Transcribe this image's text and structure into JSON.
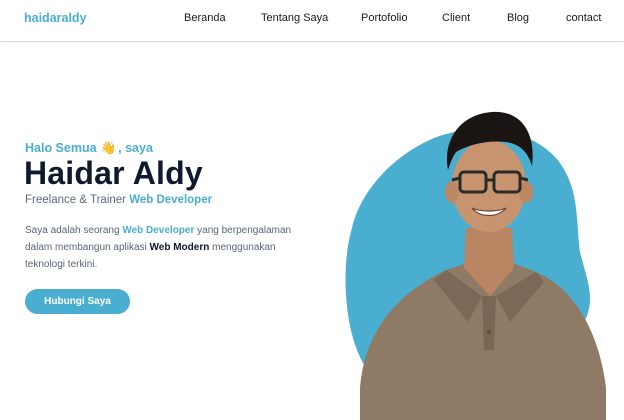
{
  "navbar": {
    "logo": "haidaraldy",
    "items": [
      {
        "label": "Beranda"
      },
      {
        "label": "Tentang Saya"
      },
      {
        "label": "Portofolio"
      },
      {
        "label": "Client"
      },
      {
        "label": "Blog"
      },
      {
        "label": "contact"
      }
    ]
  },
  "hero": {
    "greeting_prefix": "Halo Semua",
    "greeting_emoji": "👋",
    "greeting_suffix": ", saya",
    "name": "Haidar Aldy",
    "role_prefix": "Freelance & Trainer",
    "role_accent": "Web Developer",
    "desc": {
      "part1": "Saya adalah seorang",
      "accent1": "Web Developer",
      "part2": "yang berpengalaman dalam membangun aplikasi",
      "strong1": "Web Modern",
      "part3": "menggunakan teknologi terkini."
    },
    "cta_label": "Hubungi Saya"
  },
  "colors": {
    "accent": "#4aaed1",
    "heading": "#0e1a2e",
    "body_text": "#55657a"
  },
  "icons": {
    "greeting_emoji": "waving-hand-icon"
  }
}
